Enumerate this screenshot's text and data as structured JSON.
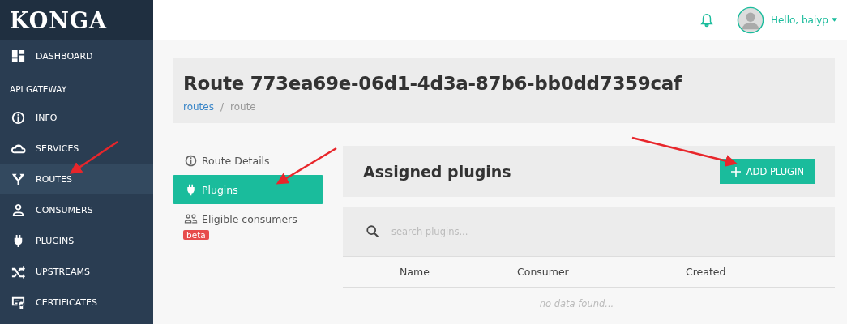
{
  "logo": "KONGA",
  "sidebar": {
    "items": [
      {
        "kind": "link",
        "label": "DASHBOARD",
        "selected": false
      },
      {
        "kind": "heading",
        "label": "API GATEWAY"
      },
      {
        "kind": "link",
        "label": "INFO",
        "selected": false
      },
      {
        "kind": "link",
        "label": "SERVICES",
        "selected": false
      },
      {
        "kind": "link",
        "label": "ROUTES",
        "selected": true
      },
      {
        "kind": "link",
        "label": "CONSUMERS",
        "selected": false
      },
      {
        "kind": "link",
        "label": "PLUGINS",
        "selected": false
      },
      {
        "kind": "link",
        "label": "UPSTREAMS",
        "selected": false
      },
      {
        "kind": "link",
        "label": "CERTIFICATES",
        "selected": false
      }
    ]
  },
  "topbar": {
    "user": "Hello, baiyp"
  },
  "page": {
    "title": "Route 773ea69e-06d1-4d3a-87b6-bb0dd7359caf",
    "breadcrumb": [
      {
        "kind": "link",
        "label": "routes"
      },
      {
        "kind": "separator",
        "label": "/"
      },
      {
        "kind": "current",
        "label": "route"
      }
    ]
  },
  "tabs": [
    {
      "label": "Route Details",
      "selected": false
    },
    {
      "label": "Plugins",
      "selected": true
    },
    {
      "label": "Eligible consumers",
      "selected": false,
      "badge": "beta"
    }
  ],
  "panel": {
    "title": "Assigned plugins",
    "button": "ADD PLUGIN",
    "search": {
      "placeholder": "search plugins..."
    },
    "table": {
      "columns": [
        "Name",
        "Consumer",
        "Created"
      ],
      "empty": "no data found..."
    }
  }
}
